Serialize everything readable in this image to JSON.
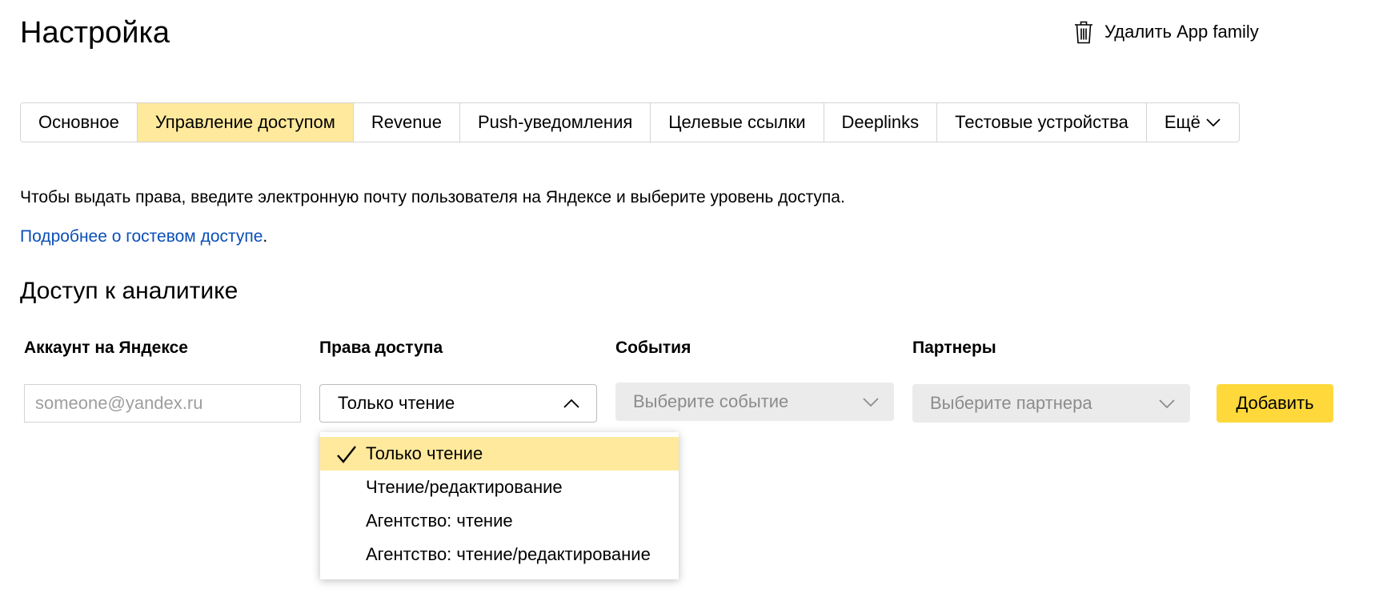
{
  "header": {
    "title": "Настройка",
    "delete_label": "Удалить App family",
    "delete_icon": "trash-icon"
  },
  "tabs": [
    {
      "label": "Основное",
      "active": false
    },
    {
      "label": "Управление доступом",
      "active": true
    },
    {
      "label": "Revenue",
      "active": false
    },
    {
      "label": "Push-уведомления",
      "active": false
    },
    {
      "label": "Целевые ссылки",
      "active": false
    },
    {
      "label": "Deeplinks",
      "active": false
    },
    {
      "label": "Тестовые устройства",
      "active": false
    },
    {
      "label": "Ещё",
      "active": false
    }
  ],
  "intro": {
    "text": "Чтобы выдать права, введите электронную почту пользователя на Яндексе и выберите уровень доступа.",
    "link_text": "Подробнее о гостевом доступе",
    "link_suffix": "."
  },
  "access": {
    "section_title": "Доступ к аналитике",
    "columns": {
      "account": "Аккаунт на Яндексе",
      "rights": "Права доступа",
      "events": "События",
      "partners": "Партнеры"
    },
    "email_placeholder": "someone@yandex.ru",
    "rights_selected": "Только чтение",
    "events_placeholder": "Выберите событие",
    "partners_placeholder": "Выберите партнера",
    "add_button": "Добавить",
    "rights_options": [
      {
        "label": "Только чтение",
        "selected": true
      },
      {
        "label": "Чтение/редактирование",
        "selected": false
      },
      {
        "label": "Агентство: чтение",
        "selected": false
      },
      {
        "label": "Агентство: чтение/редактирование",
        "selected": false
      }
    ]
  },
  "colors": {
    "active_tab": "#ffe99c",
    "primary_button": "#ffd83b",
    "link": "#0b4fb8",
    "disabled_field": "#ebebeb"
  }
}
